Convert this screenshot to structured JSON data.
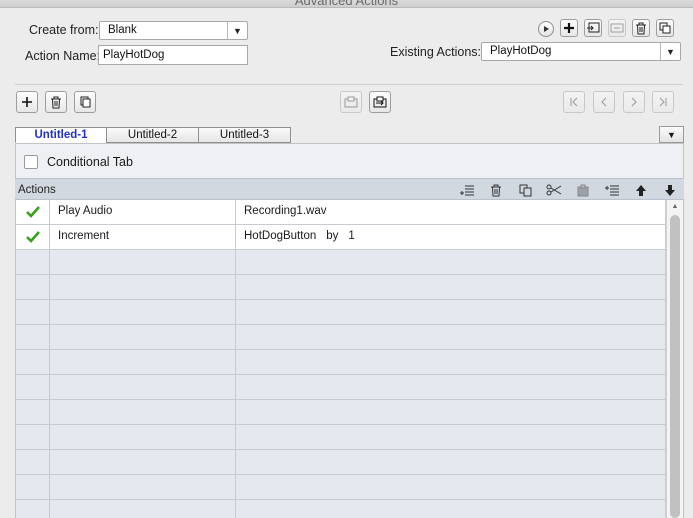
{
  "window": {
    "title": "Advanced Actions"
  },
  "form": {
    "create_from_label": "Create from:",
    "create_from_value": "Blank",
    "action_name_label": "Action Name:",
    "action_name_value": "PlayHotDog",
    "existing_actions_label": "Existing Actions:",
    "existing_actions_value": "PlayHotDog"
  },
  "tabs": [
    {
      "label": "Untitled-1",
      "active": true
    },
    {
      "label": "Untitled-2",
      "active": false
    },
    {
      "label": "Untitled-3",
      "active": false
    }
  ],
  "conditional_tab_label": "Conditional Tab",
  "actions_header": "Actions",
  "rows": [
    {
      "checked": true,
      "action": "Play Audio",
      "target": "Recording1.wav",
      "by": "",
      "amount": ""
    },
    {
      "checked": true,
      "action": "Increment",
      "target": "HotDogButton",
      "by": "by",
      "amount": "1"
    }
  ],
  "empty_row_count": 11,
  "colors": {
    "active_tab_text": "#1f2fd0",
    "check": "#35a21c",
    "header_bg": "#d1d8e0",
    "selected_row": "#ffffff",
    "empty_row": "#e5e9ef"
  },
  "icons": [
    "play-icon",
    "plus-icon",
    "save-action-icon",
    "import-icon",
    "trash-icon",
    "duplicate-icon",
    "copy-icon",
    "paste-icon",
    "scissors-icon",
    "insert-icon",
    "arrow-up-icon",
    "arrow-down-icon",
    "first-icon",
    "prev-icon",
    "next-icon",
    "last-icon",
    "checkmark-icon"
  ]
}
